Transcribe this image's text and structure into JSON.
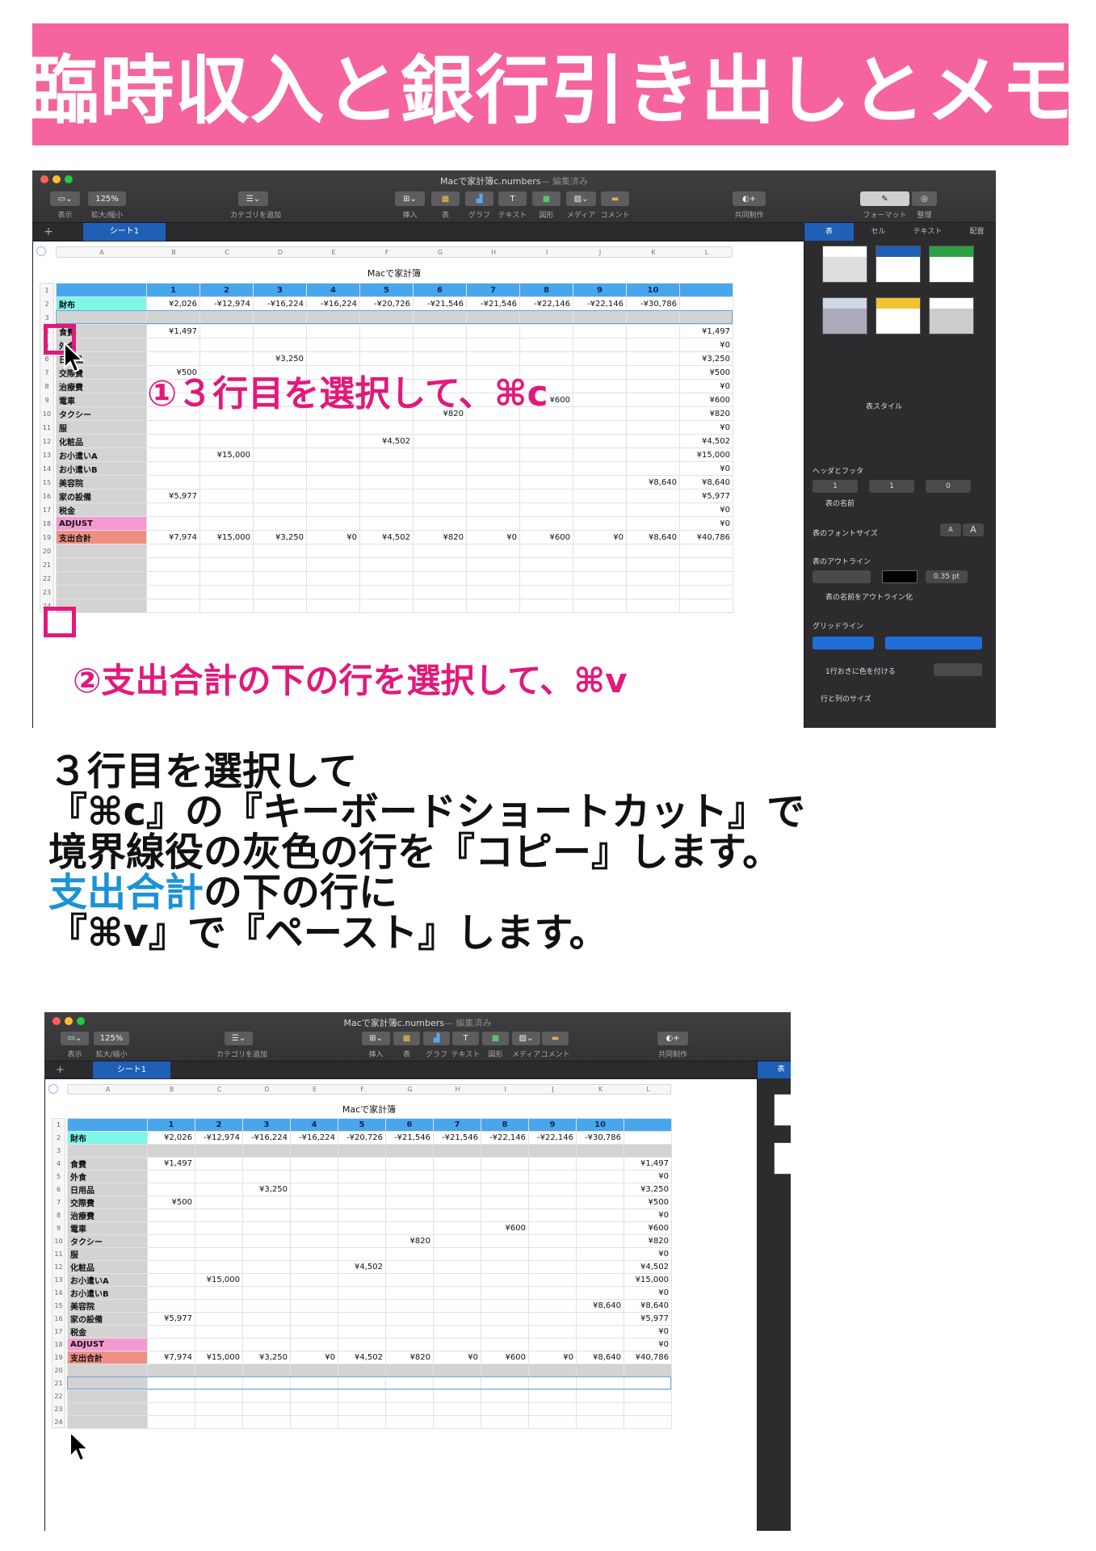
{
  "banner": {
    "title": "臨時収入と銀行引き出しとメモ"
  },
  "app": {
    "window_title": "Macで家計簿c.numbers",
    "window_status": "— 編集済み",
    "zoom": "125%",
    "toolbar_labels": {
      "view": "表示",
      "zoom": "拡大/縮小",
      "category": "カテゴリを追加",
      "insert": "挿入",
      "table": "表",
      "chart": "グラフ",
      "text": "テキスト",
      "shape": "図形",
      "media": "メディア",
      "comment": "コメント",
      "collab": "共同制作",
      "format": "フォーマット",
      "organize": "整理"
    },
    "sheet_tab": "シート1",
    "add_tab": "+",
    "table_title": "Macで家計簿",
    "column_letters": [
      "A",
      "B",
      "C",
      "D",
      "E",
      "F",
      "G",
      "H",
      "I",
      "J",
      "K",
      "L"
    ],
    "header_row": [
      "",
      "1",
      "2",
      "3",
      "4",
      "5",
      "6",
      "7",
      "8",
      "9",
      "10",
      ""
    ],
    "rows_shot1": [
      [
        "財布",
        "¥2,026",
        "-¥12,974",
        "-¥16,224",
        "-¥16,224",
        "-¥20,726",
        "-¥21,546",
        "-¥21,546",
        "-¥22,146",
        "-¥22,146",
        "-¥30,786",
        ""
      ],
      [
        "",
        "",
        "",
        "",
        "",
        "",
        "",
        "",
        "",
        "",
        "",
        ""
      ],
      [
        "食費",
        "¥1,497",
        "",
        "",
        "",
        "",
        "",
        "",
        "",
        "",
        "",
        "¥1,497"
      ],
      [
        "外食",
        "",
        "",
        "",
        "",
        "",
        "",
        "",
        "",
        "",
        "",
        "¥0"
      ],
      [
        "日用品",
        "",
        "",
        "¥3,250",
        "",
        "",
        "",
        "",
        "",
        "",
        "",
        "¥3,250"
      ],
      [
        "交際費",
        "¥500",
        "",
        "",
        "",
        "",
        "",
        "",
        "",
        "",
        "",
        "¥500"
      ],
      [
        "治療費",
        "",
        "",
        "",
        "",
        "",
        "",
        "",
        "",
        "",
        "",
        "¥0"
      ],
      [
        "電車",
        "",
        "",
        "",
        "",
        "",
        "",
        "",
        "¥600",
        "",
        "",
        "¥600"
      ],
      [
        "タクシー",
        "",
        "",
        "",
        "",
        "",
        "¥820",
        "",
        "",
        "",
        "",
        "¥820"
      ],
      [
        "服",
        "",
        "",
        "",
        "",
        "",
        "",
        "",
        "",
        "",
        "",
        "¥0"
      ],
      [
        "化粧品",
        "",
        "",
        "",
        "",
        "¥4,502",
        "",
        "",
        "",
        "",
        "",
        "¥4,502"
      ],
      [
        "お小遣いA",
        "",
        "¥15,000",
        "",
        "",
        "",
        "",
        "",
        "",
        "",
        "",
        "¥15,000"
      ],
      [
        "お小遣いB",
        "",
        "",
        "",
        "",
        "",
        "",
        "",
        "",
        "",
        "",
        "¥0"
      ],
      [
        "美容院",
        "",
        "",
        "",
        "",
        "",
        "",
        "",
        "",
        "",
        "¥8,640",
        "¥8,640"
      ],
      [
        "家の設備",
        "¥5,977",
        "",
        "",
        "",
        "",
        "",
        "",
        "",
        "",
        "",
        "¥5,977"
      ],
      [
        "税金",
        "",
        "",
        "",
        "",
        "",
        "",
        "",
        "",
        "",
        "",
        "¥0"
      ],
      [
        "ADJUST",
        "",
        "",
        "",
        "",
        "",
        "",
        "",
        "",
        "",
        "",
        "¥0"
      ],
      [
        "支出合計",
        "¥7,974",
        "¥15,000",
        "¥3,250",
        "¥0",
        "¥4,502",
        "¥820",
        "¥0",
        "¥600",
        "¥0",
        "¥8,640",
        "¥40,786"
      ]
    ],
    "row_numbers": [
      "1",
      "2",
      "3",
      "4",
      "5",
      "6",
      "7",
      "8",
      "9",
      "10",
      "11",
      "12",
      "13",
      "14",
      "15",
      "16",
      "17",
      "18",
      "19",
      "20",
      "21",
      "22",
      "23",
      "24"
    ],
    "sidebar": {
      "tabs": [
        "表",
        "セル",
        "テキスト",
        "配置"
      ],
      "table_style": "表スタイル",
      "header_footer": "ヘッダとフッタ",
      "hf_values": [
        "1",
        "1",
        "0"
      ],
      "table_name_check": "表の名前",
      "font_size": "表のフォントサイズ",
      "font_small": "A",
      "font_large": "A",
      "outline": "表のアウトライン",
      "outline_pt": "0.35 pt",
      "outline_name": "表の名前をアウトライン化",
      "gridlines": "グリッドライン",
      "alternate": "1行おきに色を付ける",
      "rowcol": "行と列のサイズ"
    }
  },
  "annotations": {
    "step1": "①３行目を選択して、⌘c",
    "step2": "②支出合計の下の行を選択して、⌘v",
    "row20": "20"
  },
  "body": {
    "line1": "３行目を選択して",
    "line2": "『⌘c』の『キーボードショートカット』で",
    "line3": "境界線役の灰色の行を『コピー』します。",
    "line4_hl": "支出合計",
    "line4_rest": "の下の行に",
    "line5": "『⌘v』で『ペースト』します。"
  },
  "colors": {
    "banner": "#f5649e",
    "annotation": "#e2197a",
    "highlight": "#1a93d6",
    "header_blue": "#48a6ec"
  }
}
